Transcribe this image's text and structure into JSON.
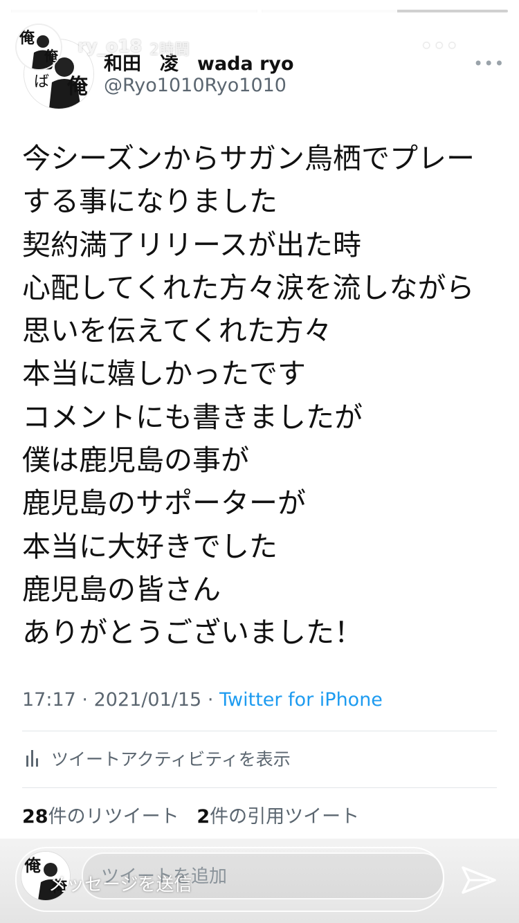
{
  "story": {
    "username": "ry_o18",
    "time_ago": "2時間",
    "progress": [
      1.0,
      0.55
    ]
  },
  "tweet": {
    "display_name": "和田　凌　wada ryo",
    "handle": "@Ryo1010Ryo1010",
    "menu_glyph": "•••",
    "body_lines": [
      "今シーズンからサガン鳥栖でプレー",
      "する事になりました",
      "契約満了リリースが出た時",
      "心配してくれた方々涙を流しながら",
      "思いを伝えてくれた方々",
      "本当に嬉しかったです",
      "コメントにも書きましたが",
      "僕は鹿児島の事が",
      "鹿児島のサポーターが",
      "本当に大好きでした",
      "鹿児島の皆さん",
      "ありがとうございました！"
    ],
    "time": "17:17",
    "date": "2021/01/15",
    "separator": "·",
    "source": "Twitter for iPhone",
    "activity_label": "ツイートアクティビティを表示",
    "retweet_count": "28",
    "retweet_label": "件のリツイート",
    "quote_count": "2",
    "quote_label": "件の引用ツイート"
  },
  "reply_bar": {
    "ghost_placeholder": "ツイートを追加"
  },
  "message_bar": {
    "placeholder": "メッセージを送信"
  },
  "icons": {
    "more": "ellipsis-icon",
    "close": "close-icon",
    "send": "paper-plane-icon",
    "activity": "bar-chart-icon"
  },
  "colors": {
    "link": "#1d9bf0",
    "secondary_text": "#5b6670"
  }
}
